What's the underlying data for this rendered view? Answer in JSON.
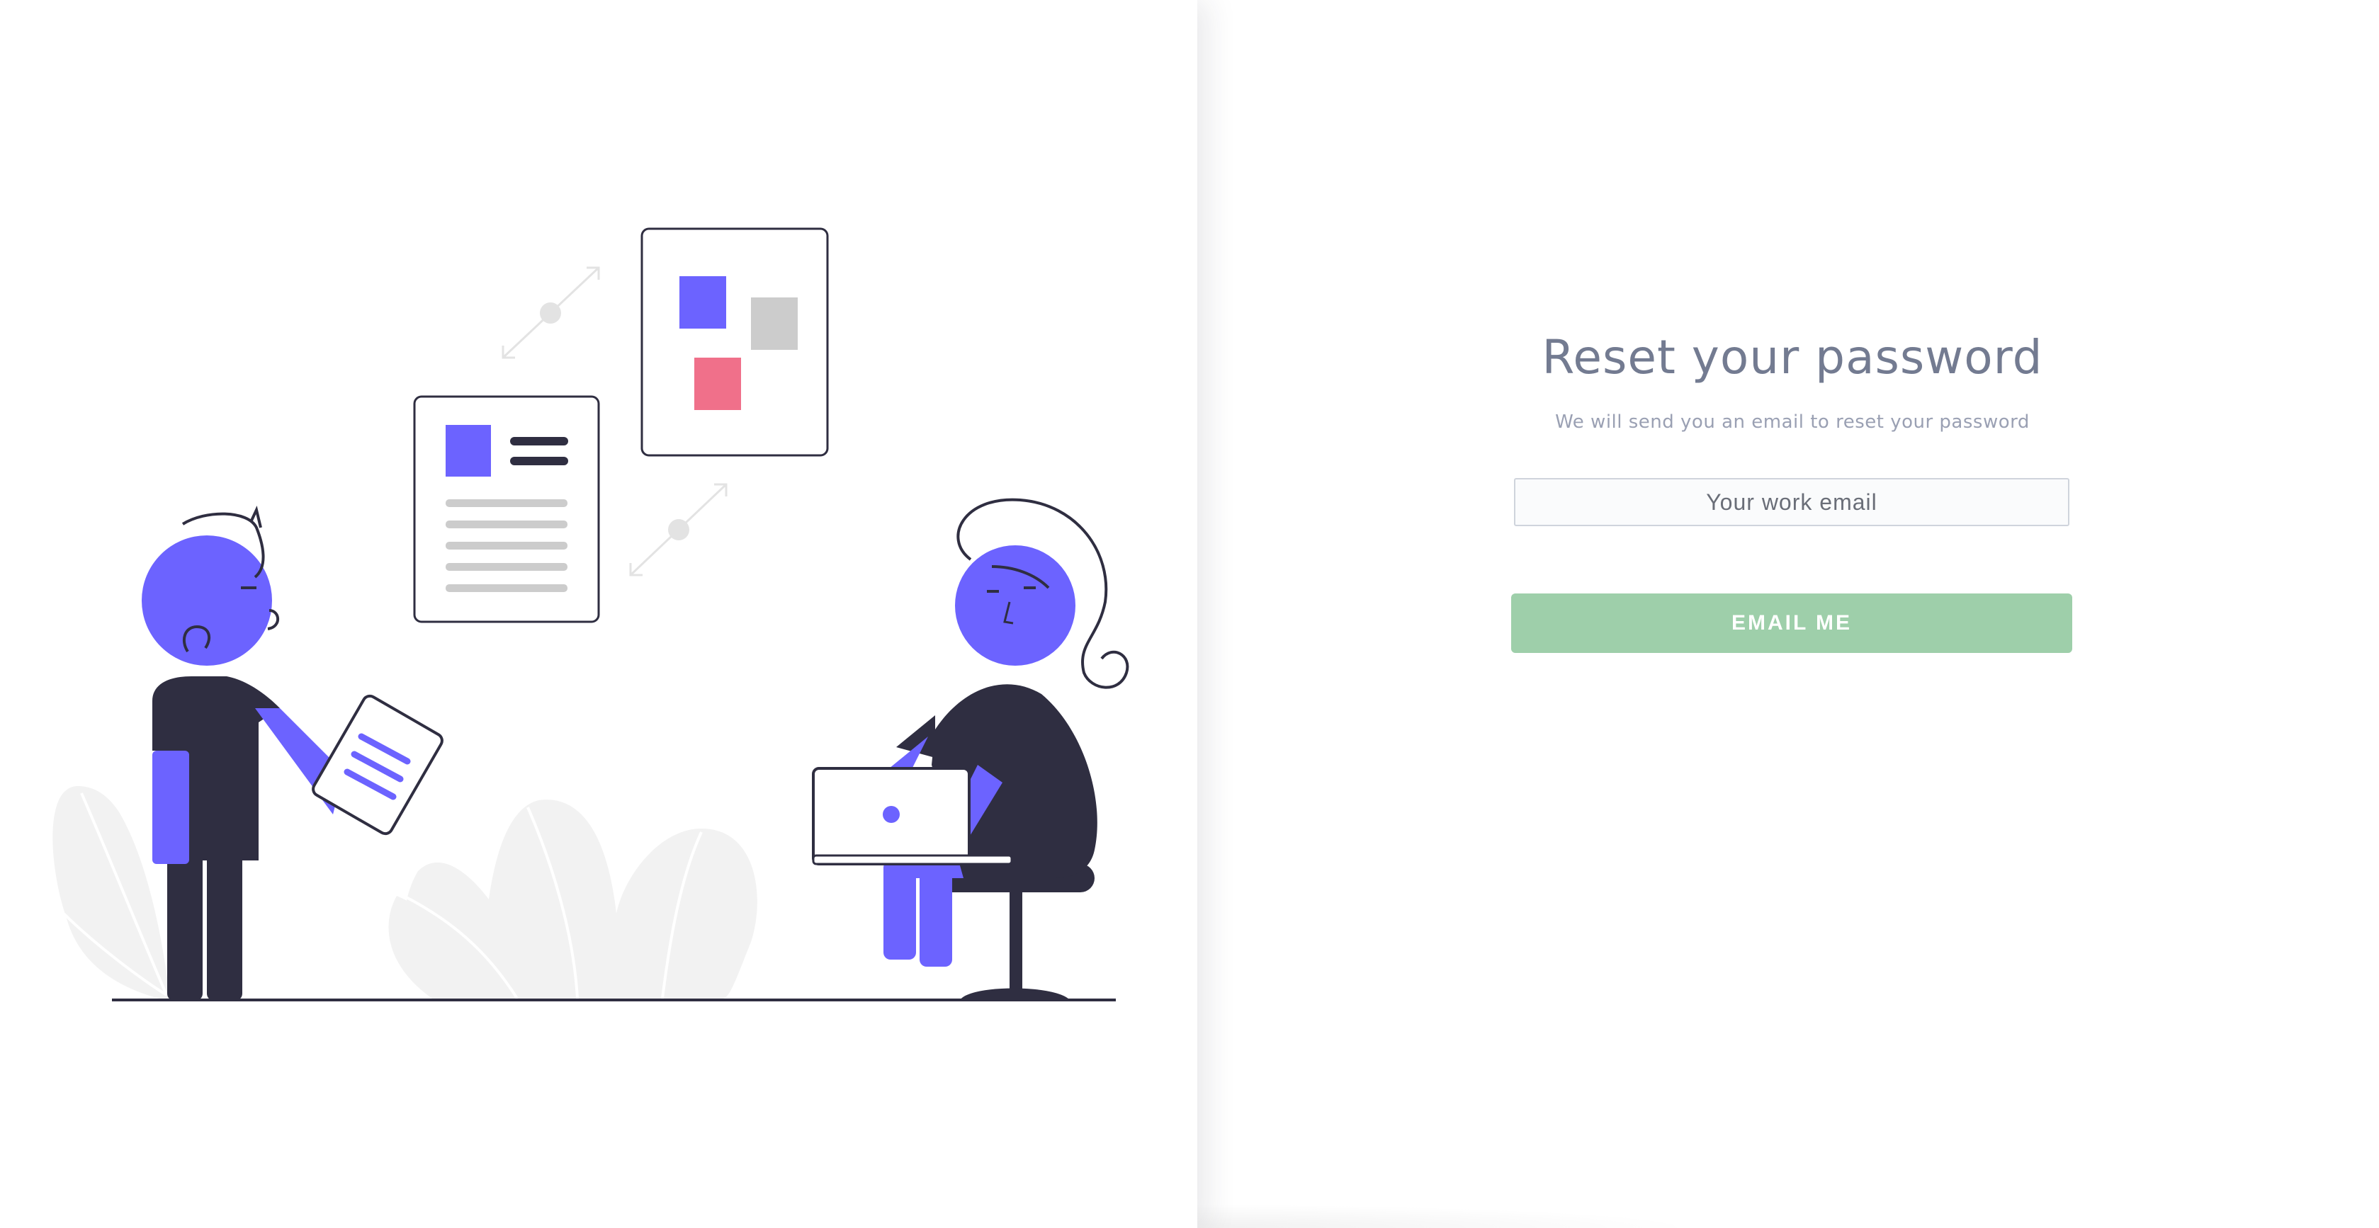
{
  "reset_form": {
    "title": "Reset your password",
    "subtitle": "We will send you an email to reset your password",
    "email_placeholder": "Your work email",
    "email_value": "",
    "submit_label": "EMAIL ME"
  },
  "colors": {
    "title": "#737b91",
    "subtitle": "#9aa0b3",
    "button": "#9ecfaa",
    "illustration_accent": "#6c63ff",
    "illustration_dark": "#2f2e41",
    "illustration_pink": "#f0708a",
    "illustration_grey": "#f2f2f2"
  },
  "illustration": {
    "description_icons": [
      "person-standing-icon",
      "person-sitting-icon",
      "laptop-icon",
      "document-icon",
      "board-icon",
      "plant-icon",
      "arrow-icon"
    ]
  }
}
